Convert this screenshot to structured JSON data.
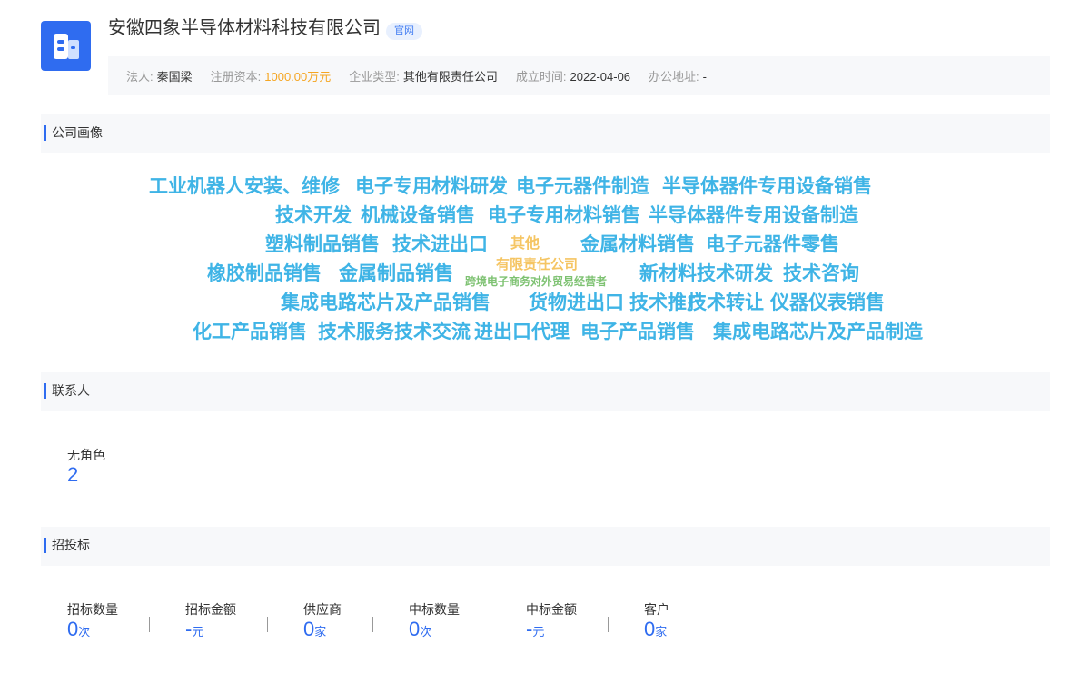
{
  "company": {
    "name": "安徽四象半导体材料科技有限公司",
    "badge": "官网",
    "logo_icon": "building-icon",
    "brand_color": "#2f6cf0"
  },
  "info": [
    {
      "label": "法人:",
      "value": "秦国梁",
      "highlight": false
    },
    {
      "label": "注册资本:",
      "value": "1000.00万元",
      "highlight": true
    },
    {
      "label": "企业类型:",
      "value": "其他有限责任公司",
      "highlight": false
    },
    {
      "label": "成立时间:",
      "value": "2022-04-06",
      "highlight": false
    },
    {
      "label": "办公地址:",
      "value": "-",
      "highlight": false
    }
  ],
  "sections": {
    "portrait": "公司画像",
    "contacts": "联系人",
    "bidding": "招投标"
  },
  "word_cloud": [
    "工业机器人安装、维修",
    "电子专用材料研发",
    "电子元器件制造",
    "半导体器件专用设备销售",
    "技术开发",
    "机械设备销售",
    "电子专用材料销售",
    "半导体器件专用设备制造",
    "塑料制品销售",
    "技术进出口",
    "其他",
    "金属材料销售",
    "电子元器件零售",
    "橡胶制品销售",
    "金属制品销售",
    "有限责任公司",
    "跨境电子商务对外贸易经营者",
    "新材料技术研发",
    "技术咨询",
    "集成电路芯片及产品销售",
    "货物进出口",
    "技术推广",
    "技术转让",
    "仪器仪表销售",
    "化工产品销售",
    "技术服务",
    "技术交流",
    "进出口代理",
    "电子产品销售",
    "集成电路芯片及产品制造"
  ],
  "contacts": {
    "label": "无角色",
    "value": "2"
  },
  "bidding": [
    {
      "label": "招标数量",
      "value": "0",
      "unit": "次"
    },
    {
      "label": "招标金额",
      "value": "-",
      "unit": "元"
    },
    {
      "label": "供应商",
      "value": "0",
      "unit": "家"
    },
    {
      "label": "中标数量",
      "value": "0",
      "unit": "次"
    },
    {
      "label": "中标金额",
      "value": "-",
      "unit": "元"
    },
    {
      "label": "客户",
      "value": "0",
      "unit": "家"
    }
  ]
}
